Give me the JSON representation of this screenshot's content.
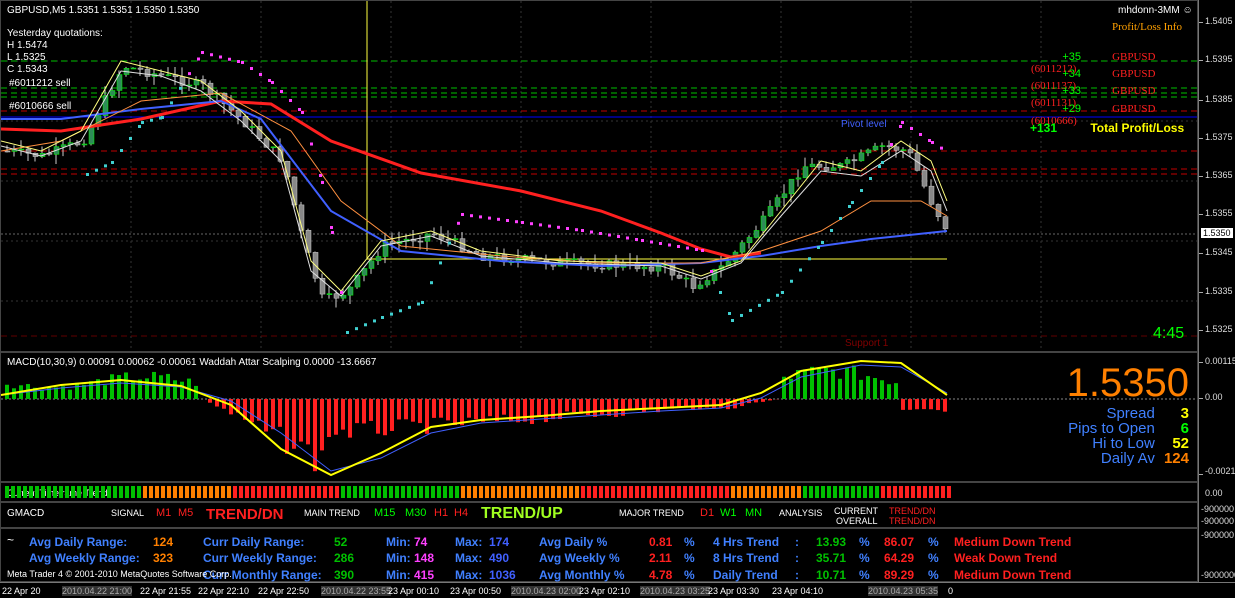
{
  "header": {
    "symbol_line": "GBPUSD,M5  1.5351 1.5351 1.5350 1.5350",
    "account": "mhdonn-3MM ☺",
    "pl_title": "Profit/Loss Info"
  },
  "yesterday": {
    "title": "Yesterday quotations:",
    "h": "H 1.5474",
    "l": "L 1.5325",
    "c": "C 1.5343"
  },
  "orders_on_chart": [
    "#6011212 sell",
    "#6010666 sell"
  ],
  "pl_rows": [
    {
      "pips": "+35",
      "label": "GBPUSD (6011212)"
    },
    {
      "pips": "+34",
      "label": "GBPUSD (6011137)"
    },
    {
      "pips": "+33",
      "label": "GBPUSD (6011131)"
    },
    {
      "pips": "+29",
      "label": "GBPUSD (6010666)"
    }
  ],
  "pl_total": {
    "pips": "+131",
    "label": "Total Profit/Loss"
  },
  "levels": {
    "pivot": "Pivot level",
    "support": "Support 1"
  },
  "timer": "4:45",
  "price_axis": [
    "1.5405",
    "1.5395",
    "1.5385",
    "1.5375",
    "1.5365",
    "1.5355",
    "1.5345",
    "1.5335",
    "1.5325"
  ],
  "current_price_tag": "1.5350",
  "current_price_level": 1.535,
  "macd": {
    "title": "MACD(10,30,9) 0.00091 0.00062 -0.00061  Waddah Attar Scalping 0.0000 -13.6667",
    "axis": [
      "0.00115",
      "0.00",
      "-0.0021"
    ]
  },
  "info_box": {
    "price": "1.5350",
    "rows": [
      {
        "label": "Spread",
        "value": "3",
        "color": "#ffff00"
      },
      {
        "label": "Pips to Open",
        "value": "6",
        "color": "#00ff00"
      },
      {
        "label": "Hi to Low",
        "value": "52",
        "color": "#ffff00"
      },
      {
        "label": "Daily Av",
        "value": "124",
        "color": "#ff8000"
      }
    ]
  },
  "trend_bar": {
    "label": "Current Timeframe Trend",
    "axis": "0.00"
  },
  "gmacd": {
    "title": "GMACD",
    "signal_label": "SIGNAL",
    "m1": "M1",
    "m5": "M5",
    "signal_trend": "TREND/DN",
    "main_label": "MAIN TREND",
    "m15": "M15",
    "m30": "M30",
    "h1": "H1",
    "h4": "H4",
    "main_trend": "TREND/UP",
    "major_label": "MAJOR TREND",
    "d1": "D1",
    "w1": "W1",
    "mn": "MN",
    "analysis_label": "ANALYSIS",
    "current": "CURRENT",
    "overall": "OVERALL",
    "trend_dn1": "TREND/DN",
    "trend_dn2": "TREND/DN",
    "axis1": "-900000",
    "axis2": "-900000"
  },
  "stats": {
    "rows": [
      {
        "a_label": "Avg Daily Range:",
        "a_val": "124",
        "b_label": "Curr Daily Range:",
        "b_val": "52",
        "min_label": "Min:",
        "min_val": "74",
        "max_label": "Max:",
        "max_val": "174",
        "pct_label": "Avg Daily %",
        "pct_val": "0.81",
        "pct_sym": "%",
        "trend_label": "4 Hrs Trend",
        "colon": ":",
        "up": "13.93",
        "up_sym": "%",
        "dn": "86.07",
        "dn_sym": "%",
        "result": "Medium Down Trend"
      },
      {
        "a_label": "Avg Weekly Range:",
        "a_val": "323",
        "b_label": "Curr Weekly Range:",
        "b_val": "286",
        "min_label": "Min:",
        "min_val": "148",
        "max_label": "Max:",
        "max_val": "490",
        "pct_label": "Avg Weekly %",
        "pct_val": "2.11",
        "pct_sym": "%",
        "trend_label": "8 Hrs Trend",
        "colon": ":",
        "up": "35.71",
        "up_sym": "%",
        "dn": "64.29",
        "dn_sym": "%",
        "result": "Weak Down Trend"
      },
      {
        "a_label": "",
        "a_val": "",
        "b_label": "Curr Monthly Range:",
        "b_val": "390",
        "min_label": "Min:",
        "min_val": "415",
        "max_label": "Max:",
        "max_val": "1036",
        "pct_label": "Avg Monthly %",
        "pct_val": "4.78",
        "pct_sym": "%",
        "trend_label": "Daily Trend",
        "colon": ":",
        "up": "10.71",
        "up_sym": "%",
        "dn": "89.29",
        "dn_sym": "%",
        "result": "Medium Down Trend"
      }
    ],
    "copyright": "Meta Trader 4 © 2001-2010 MetaQuotes Software Corp.",
    "tilde": "~",
    "axis1": "-900000",
    "axis2": "-9000000"
  },
  "time_axis": [
    "22 Apr 20",
    "2010.04.22 21:00",
    "22 Apr 21:55",
    "22 Apr 22:10",
    "22 Apr 22:50",
    "2010.04.22 23:55",
    "23 Apr 00:10",
    "23 Apr 00:50",
    "2010.04.23 02:00",
    "23 Apr 02:10",
    "2010.04.23 03:25",
    "23 Apr 03:30",
    "23 Apr 04:10",
    "2010.04.23 05:35",
    "0"
  ],
  "colors": {
    "bull": "#00ff00",
    "bear": "#ff0000",
    "ema_fast": "#4060ff",
    "ema_slow": "#ff2020",
    "psar": "#ff40ff",
    "psar_low": "#40d0d0",
    "accent": "#ff8000"
  }
}
